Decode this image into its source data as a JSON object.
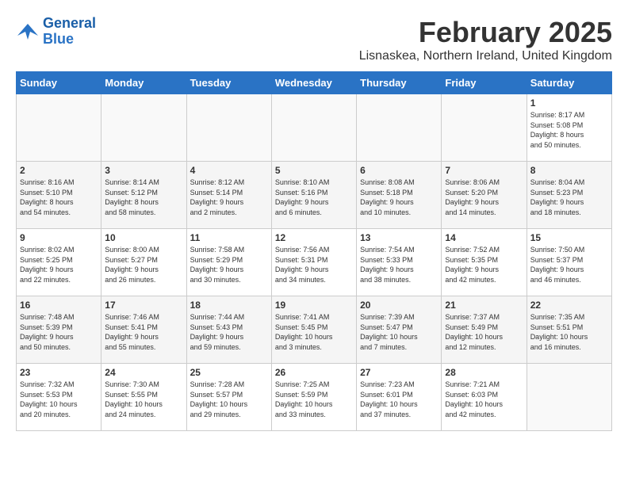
{
  "logo": {
    "line1": "General",
    "line2": "Blue"
  },
  "title": "February 2025",
  "subtitle": "Lisnaskea, Northern Ireland, United Kingdom",
  "headers": [
    "Sunday",
    "Monday",
    "Tuesday",
    "Wednesday",
    "Thursday",
    "Friday",
    "Saturday"
  ],
  "weeks": [
    [
      {
        "day": "",
        "info": ""
      },
      {
        "day": "",
        "info": ""
      },
      {
        "day": "",
        "info": ""
      },
      {
        "day": "",
        "info": ""
      },
      {
        "day": "",
        "info": ""
      },
      {
        "day": "",
        "info": ""
      },
      {
        "day": "1",
        "info": "Sunrise: 8:17 AM\nSunset: 5:08 PM\nDaylight: 8 hours\nand 50 minutes."
      }
    ],
    [
      {
        "day": "2",
        "info": "Sunrise: 8:16 AM\nSunset: 5:10 PM\nDaylight: 8 hours\nand 54 minutes."
      },
      {
        "day": "3",
        "info": "Sunrise: 8:14 AM\nSunset: 5:12 PM\nDaylight: 8 hours\nand 58 minutes."
      },
      {
        "day": "4",
        "info": "Sunrise: 8:12 AM\nSunset: 5:14 PM\nDaylight: 9 hours\nand 2 minutes."
      },
      {
        "day": "5",
        "info": "Sunrise: 8:10 AM\nSunset: 5:16 PM\nDaylight: 9 hours\nand 6 minutes."
      },
      {
        "day": "6",
        "info": "Sunrise: 8:08 AM\nSunset: 5:18 PM\nDaylight: 9 hours\nand 10 minutes."
      },
      {
        "day": "7",
        "info": "Sunrise: 8:06 AM\nSunset: 5:20 PM\nDaylight: 9 hours\nand 14 minutes."
      },
      {
        "day": "8",
        "info": "Sunrise: 8:04 AM\nSunset: 5:23 PM\nDaylight: 9 hours\nand 18 minutes."
      }
    ],
    [
      {
        "day": "9",
        "info": "Sunrise: 8:02 AM\nSunset: 5:25 PM\nDaylight: 9 hours\nand 22 minutes."
      },
      {
        "day": "10",
        "info": "Sunrise: 8:00 AM\nSunset: 5:27 PM\nDaylight: 9 hours\nand 26 minutes."
      },
      {
        "day": "11",
        "info": "Sunrise: 7:58 AM\nSunset: 5:29 PM\nDaylight: 9 hours\nand 30 minutes."
      },
      {
        "day": "12",
        "info": "Sunrise: 7:56 AM\nSunset: 5:31 PM\nDaylight: 9 hours\nand 34 minutes."
      },
      {
        "day": "13",
        "info": "Sunrise: 7:54 AM\nSunset: 5:33 PM\nDaylight: 9 hours\nand 38 minutes."
      },
      {
        "day": "14",
        "info": "Sunrise: 7:52 AM\nSunset: 5:35 PM\nDaylight: 9 hours\nand 42 minutes."
      },
      {
        "day": "15",
        "info": "Sunrise: 7:50 AM\nSunset: 5:37 PM\nDaylight: 9 hours\nand 46 minutes."
      }
    ],
    [
      {
        "day": "16",
        "info": "Sunrise: 7:48 AM\nSunset: 5:39 PM\nDaylight: 9 hours\nand 50 minutes."
      },
      {
        "day": "17",
        "info": "Sunrise: 7:46 AM\nSunset: 5:41 PM\nDaylight: 9 hours\nand 55 minutes."
      },
      {
        "day": "18",
        "info": "Sunrise: 7:44 AM\nSunset: 5:43 PM\nDaylight: 9 hours\nand 59 minutes."
      },
      {
        "day": "19",
        "info": "Sunrise: 7:41 AM\nSunset: 5:45 PM\nDaylight: 10 hours\nand 3 minutes."
      },
      {
        "day": "20",
        "info": "Sunrise: 7:39 AM\nSunset: 5:47 PM\nDaylight: 10 hours\nand 7 minutes."
      },
      {
        "day": "21",
        "info": "Sunrise: 7:37 AM\nSunset: 5:49 PM\nDaylight: 10 hours\nand 12 minutes."
      },
      {
        "day": "22",
        "info": "Sunrise: 7:35 AM\nSunset: 5:51 PM\nDaylight: 10 hours\nand 16 minutes."
      }
    ],
    [
      {
        "day": "23",
        "info": "Sunrise: 7:32 AM\nSunset: 5:53 PM\nDaylight: 10 hours\nand 20 minutes."
      },
      {
        "day": "24",
        "info": "Sunrise: 7:30 AM\nSunset: 5:55 PM\nDaylight: 10 hours\nand 24 minutes."
      },
      {
        "day": "25",
        "info": "Sunrise: 7:28 AM\nSunset: 5:57 PM\nDaylight: 10 hours\nand 29 minutes."
      },
      {
        "day": "26",
        "info": "Sunrise: 7:25 AM\nSunset: 5:59 PM\nDaylight: 10 hours\nand 33 minutes."
      },
      {
        "day": "27",
        "info": "Sunrise: 7:23 AM\nSunset: 6:01 PM\nDaylight: 10 hours\nand 37 minutes."
      },
      {
        "day": "28",
        "info": "Sunrise: 7:21 AM\nSunset: 6:03 PM\nDaylight: 10 hours\nand 42 minutes."
      },
      {
        "day": "",
        "info": ""
      }
    ]
  ]
}
